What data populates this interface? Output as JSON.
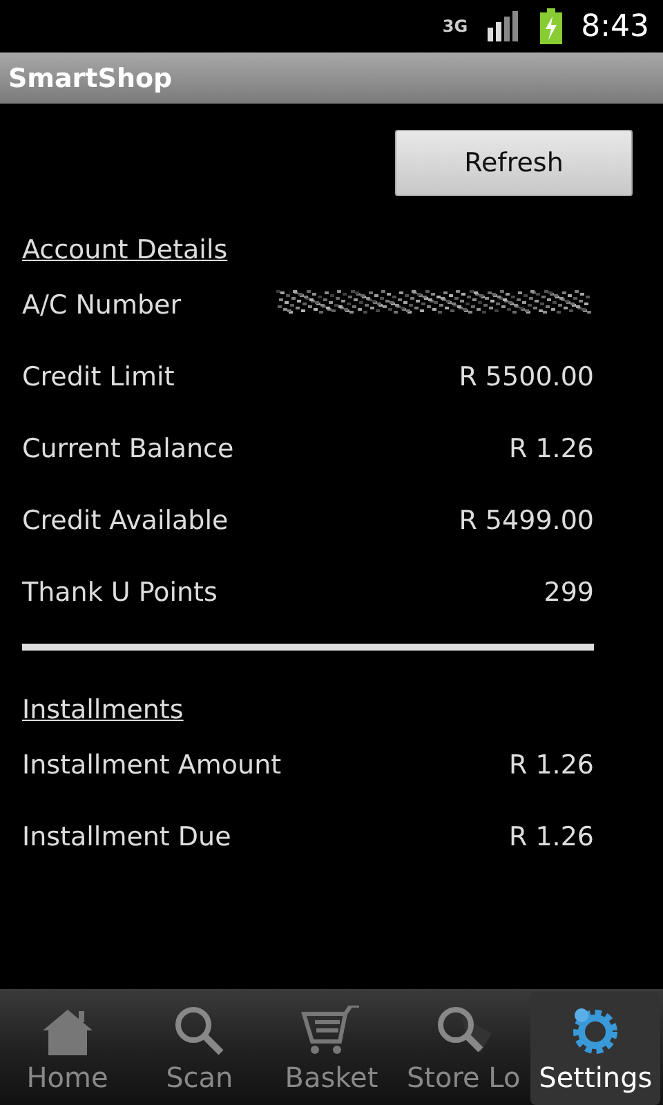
{
  "status_bar": {
    "network": "3G",
    "time": "8:43"
  },
  "title_bar": {
    "title": "SmartShop"
  },
  "refresh_button": {
    "label": "Refresh"
  },
  "sections": [
    {
      "heading": "Account Details",
      "rows": [
        {
          "kind": "redacted",
          "label": "A/C Number"
        },
        {
          "kind": "text",
          "label": "Credit Limit",
          "value": "R 5500.00"
        },
        {
          "kind": "text",
          "label": "Current Balance",
          "value": "R 1.26"
        },
        {
          "kind": "text",
          "label": "Credit Available",
          "value": "R 5499.00"
        },
        {
          "kind": "text",
          "label": "Thank U Points",
          "value": "299"
        }
      ]
    },
    {
      "heading": "Installments",
      "rows": [
        {
          "kind": "text",
          "label": "Installment Amount",
          "value": "R 1.26"
        },
        {
          "kind": "text",
          "label": "Installment Due",
          "value": "R 1.26"
        }
      ]
    }
  ],
  "tabs": [
    {
      "kind": "home",
      "label": "Home",
      "selected": false
    },
    {
      "kind": "search",
      "label": "Scan",
      "selected": false
    },
    {
      "kind": "cart",
      "label": "Basket",
      "selected": false
    },
    {
      "kind": "locate",
      "label": "Store Lo",
      "selected": false
    },
    {
      "kind": "gear",
      "label": "Settings",
      "selected": true
    }
  ]
}
